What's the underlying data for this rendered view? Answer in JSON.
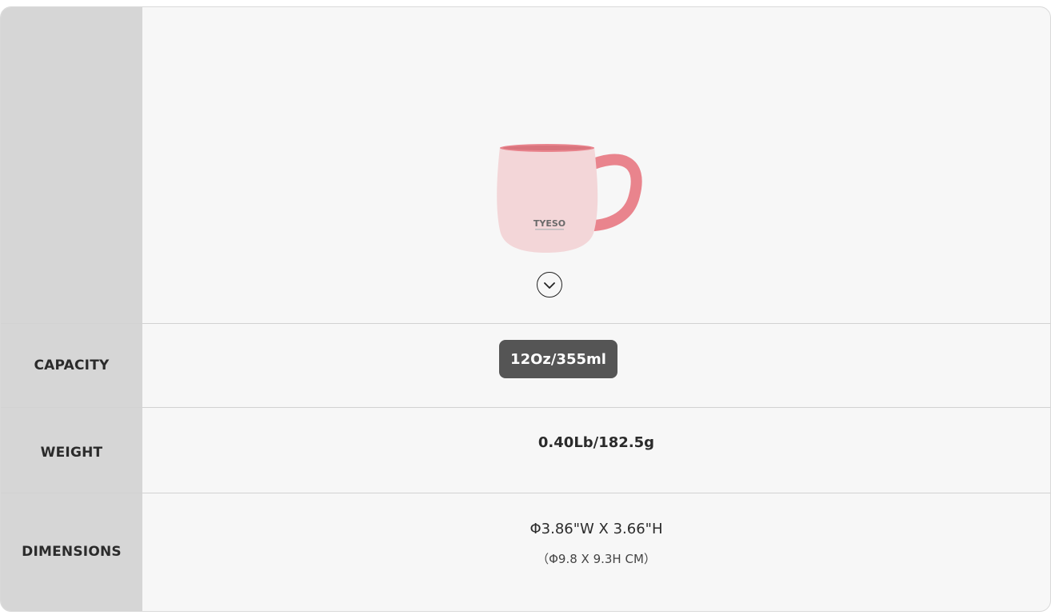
{
  "rows": {
    "capacity": {
      "label": "CAPACITY",
      "value": "12Oz/355ml"
    },
    "weight": {
      "label": "WEIGHT",
      "value": "0.40Lb/182.5g"
    },
    "dimensions": {
      "label": "DIMENSIONS",
      "value_main": "Φ3.86\"W X 3.66\"H",
      "value_sub": "（Φ9.8 X 9.3H CM）"
    }
  },
  "product": {
    "brand_logo_text": "TYESO",
    "icon": "chevron-down-icon",
    "mug_color": "#f3d6d8",
    "accent_color": "#e9848d"
  }
}
